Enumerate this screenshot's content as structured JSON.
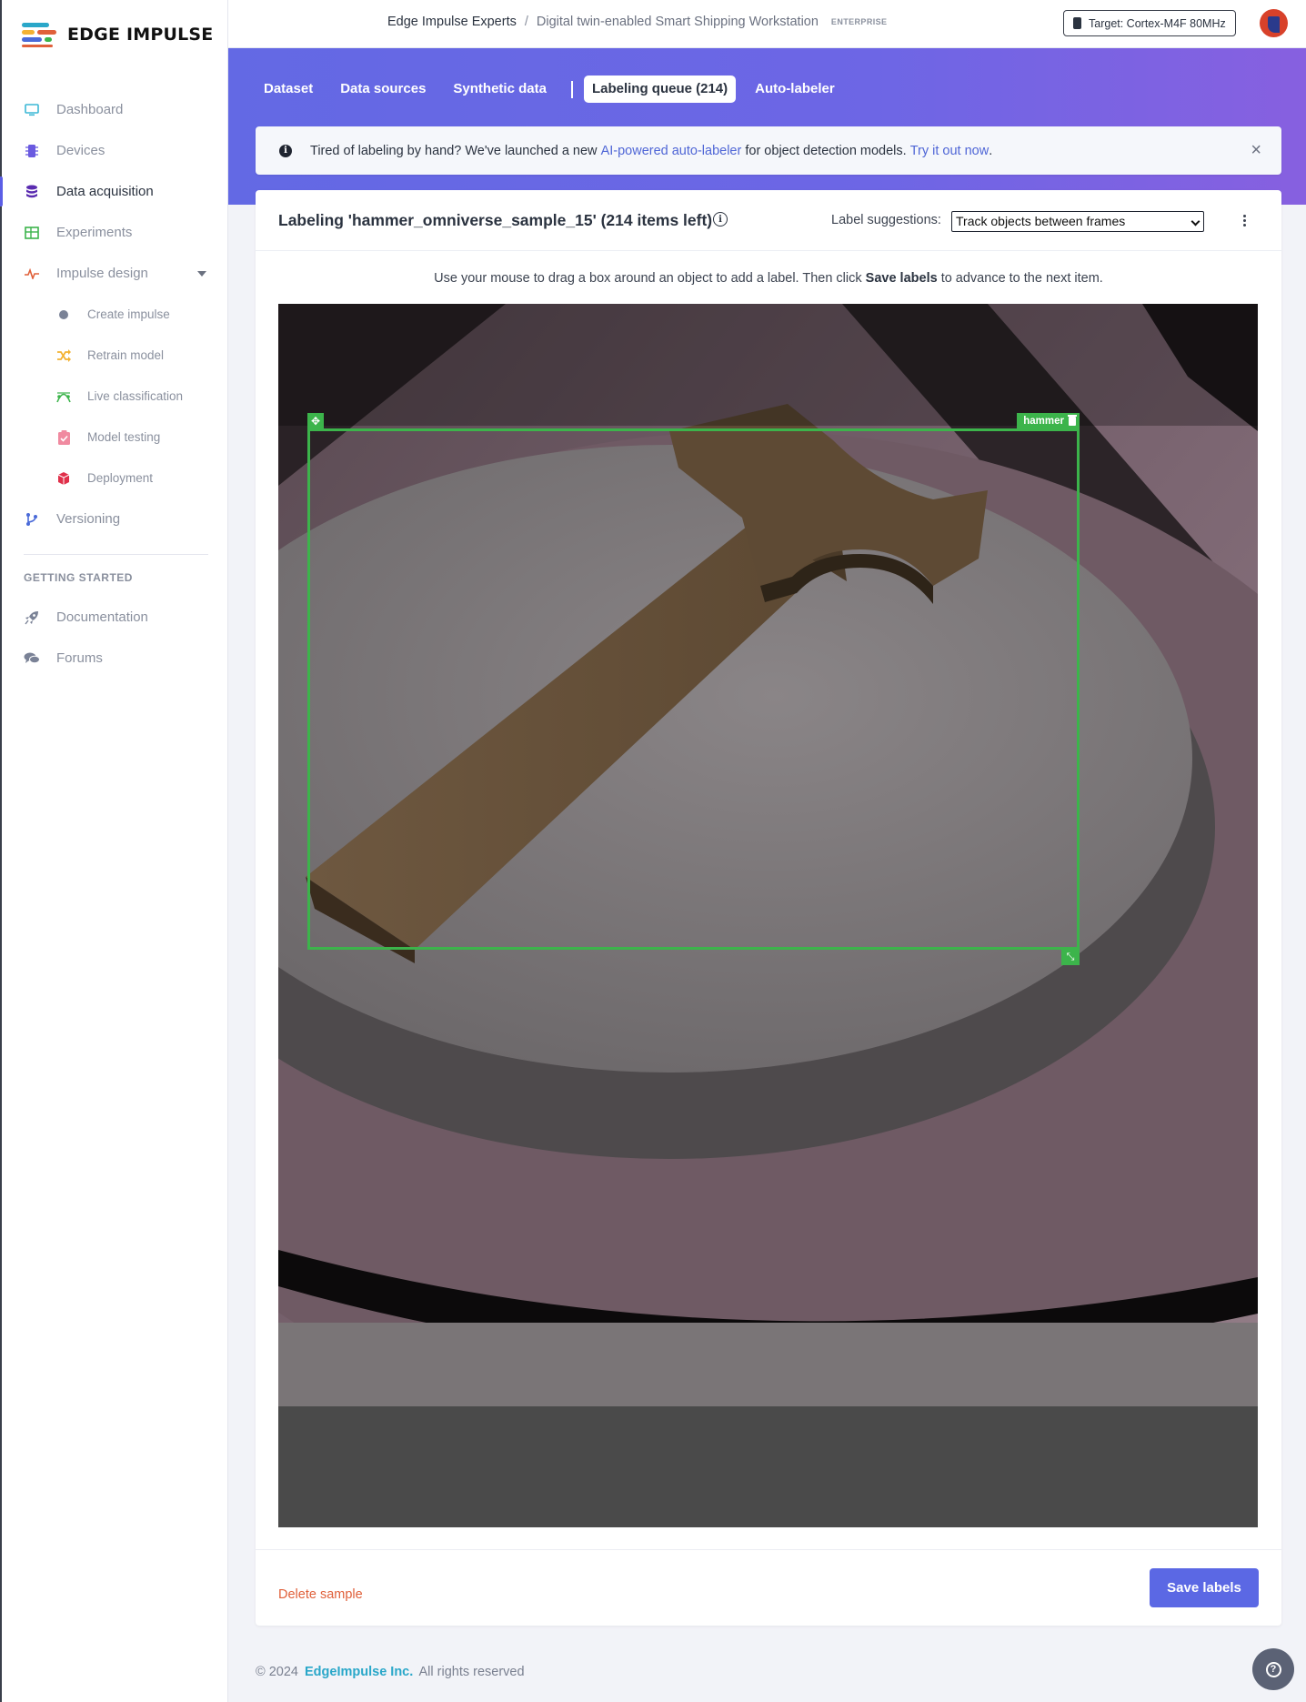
{
  "brand": {
    "name": "EDGE IMPULSE"
  },
  "sidebar": {
    "items": [
      {
        "label": "Dashboard",
        "icon": "monitor-icon"
      },
      {
        "label": "Devices",
        "icon": "chip-icon"
      },
      {
        "label": "Data acquisition",
        "icon": "database-icon",
        "active": true
      },
      {
        "label": "Experiments",
        "icon": "table-icon"
      },
      {
        "label": "Impulse design",
        "icon": "pulse-icon"
      }
    ],
    "sub_items": [
      {
        "label": "Create impulse",
        "icon": "dot-icon"
      },
      {
        "label": "Retrain model",
        "icon": "shuffle-icon"
      },
      {
        "label": "Live classification",
        "icon": "curve-icon"
      },
      {
        "label": "Model testing",
        "icon": "clipboard-check-icon"
      },
      {
        "label": "Deployment",
        "icon": "cube-icon"
      }
    ],
    "versioning": "Versioning",
    "section_title": "GETTING STARTED",
    "getting_started": [
      {
        "label": "Documentation",
        "icon": "rocket-icon"
      },
      {
        "label": "Forums",
        "icon": "comments-icon"
      }
    ]
  },
  "topbar": {
    "org": "Edge Impulse Experts",
    "separator": "/",
    "project": "Digital twin-enabled Smart Shipping Workstation",
    "badge": "ENTERPRISE",
    "target": "Target: Cortex-M4F 80MHz"
  },
  "tabs": [
    {
      "label": "Dataset"
    },
    {
      "label": "Data sources"
    },
    {
      "label": "Synthetic data"
    },
    {
      "label": "Labeling queue (214)",
      "active": true
    },
    {
      "label": "Auto-labeler"
    }
  ],
  "alert": {
    "prefix": "Tired of labeling by hand? We've launched a new",
    "link1": "AI-powered auto-labeler",
    "middle": "for object detection models.",
    "link2": "Try it out now",
    "suffix": ".",
    "close": "×"
  },
  "card": {
    "title": "Labeling 'hammer_omniverse_sample_15' (214 items left)",
    "suggestions_label": "Label suggestions:",
    "suggestions_value": "Track objects between frames",
    "instructions_pre": "Use your mouse to drag a box around an object to add a label. Then click",
    "instructions_bold": "Save labels",
    "instructions_post": "to advance to the next item."
  },
  "bounding_box": {
    "label": "hammer",
    "color": "#3cb44b"
  },
  "footer_actions": {
    "delete": "Delete sample",
    "save": "Save labels"
  },
  "footer": {
    "copyright_prefix": "© 2024",
    "company": "EdgeImpulse Inc.",
    "rights": "All rights reserved"
  },
  "colors": {
    "accent": "#5b68e4",
    "header_gradient_start": "#6369e4",
    "header_gradient_end": "#8760e0",
    "danger": "#e0603a",
    "link": "#4f66d6"
  }
}
